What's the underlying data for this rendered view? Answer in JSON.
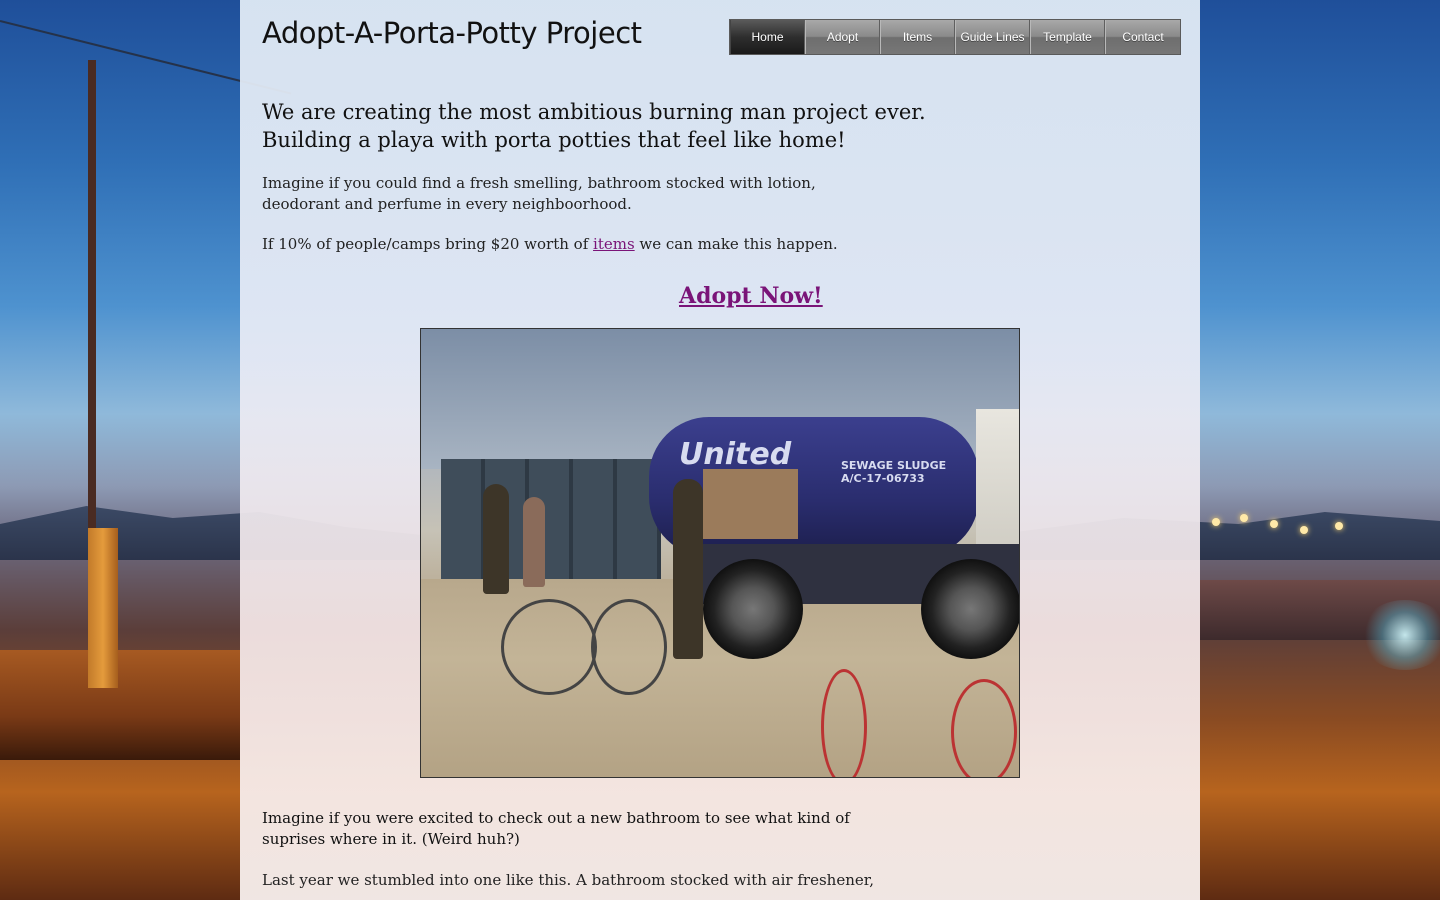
{
  "site": {
    "title": "Adopt-A-Porta-Potty Project"
  },
  "nav": {
    "items": [
      {
        "label": "Home",
        "active": true
      },
      {
        "label": "Adopt",
        "active": false
      },
      {
        "label": "Items",
        "active": false
      },
      {
        "label": "Guide Lines",
        "active": false
      },
      {
        "label": "Template",
        "active": false
      },
      {
        "label": "Contact",
        "active": false
      }
    ]
  },
  "main": {
    "headline_line1": "We are creating the most ambitious burning man project ever.",
    "headline_line2": "Building a playa with porta potties that feel like home!",
    "intro_line1": "Imagine if you could find a fresh smelling, bathroom stocked with  lotion,",
    "intro_line2": "deodorant and perfume in every neighboorhood.",
    "pledge_before": "If 10% of people/camps bring $20 worth of ",
    "pledge_link": "items",
    "pledge_after": " we can make this happen.",
    "cta_label": "Adopt Now!",
    "photo": {
      "tank_brand": "United",
      "tank_label_line1": "SEWAGE SLUDGE",
      "tank_label_line2": "A/C-17-06733"
    },
    "lower_line1": "Imagine if you were excited to check out a new bathroom to see what kind of",
    "lower_line2": "suprises where in it.  (Weird huh?)",
    "lower_line3": "Last year we stumbled into one like this. A bathroom stocked with air freshener,"
  },
  "colors": {
    "link": "#7a1478",
    "nav_active": "#1a1a1a",
    "nav_default": "#8a8a8a"
  }
}
